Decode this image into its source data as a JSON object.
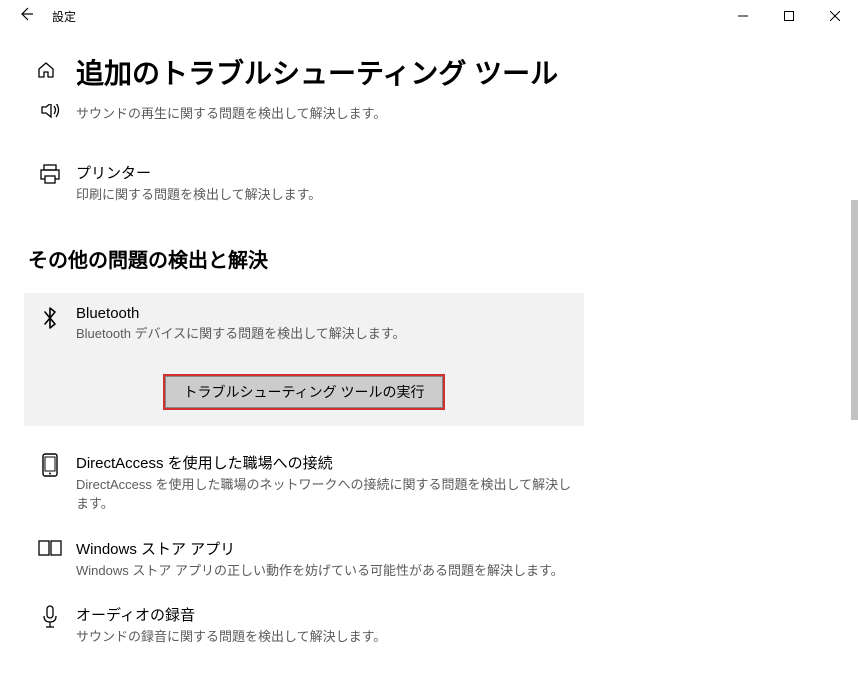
{
  "titlebar": {
    "title": "設定"
  },
  "page_title": "追加のトラブルシューティング ツール",
  "items_top": [
    {
      "title": "",
      "desc": "サウンドの再生に関する問題を検出して解決します。"
    },
    {
      "title": "プリンター",
      "desc": "印刷に関する問題を検出して解決します。"
    }
  ],
  "section_title": "その他の問題の検出と解決",
  "selected": {
    "title": "Bluetooth",
    "desc": "Bluetooth デバイスに関する問題を検出して解決します。",
    "run_label": "トラブルシューティング ツールの実行"
  },
  "items_below": [
    {
      "title": "DirectAccess を使用した職場への接続",
      "desc": "DirectAccess を使用した職場のネットワークへの接続に関する問題を検出して解決します。"
    },
    {
      "title": "Windows ストア アプリ",
      "desc": "Windows ストア アプリの正しい動作を妨げている可能性がある問題を解決します。"
    },
    {
      "title": "オーディオの録音",
      "desc": "サウンドの録音に関する問題を検出して解決します。"
    }
  ]
}
